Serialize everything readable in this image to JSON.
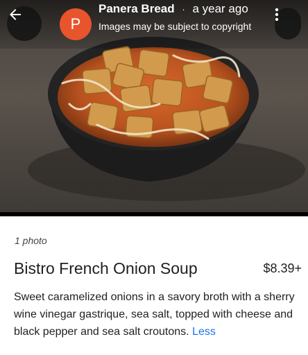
{
  "header": {
    "author": "Panera Bread",
    "separator": "·",
    "time": "a year ago",
    "notice": "Images may be subject to copyright",
    "avatar_letter": "P"
  },
  "colors": {
    "avatar": "#e8542b",
    "link": "#1a73e8"
  },
  "icons": {
    "back": "arrow-left-icon",
    "more": "more-vertical-icon"
  },
  "info": {
    "photo_count": "1 photo",
    "name": "Bistro French Onion Soup",
    "price": "$8.39+",
    "description": "Sweet caramelized onions in a savory broth with a sherry wine vinegar gastrique, sea salt, topped with cheese and black pepper and sea salt croutons.",
    "less_label": "Less"
  }
}
